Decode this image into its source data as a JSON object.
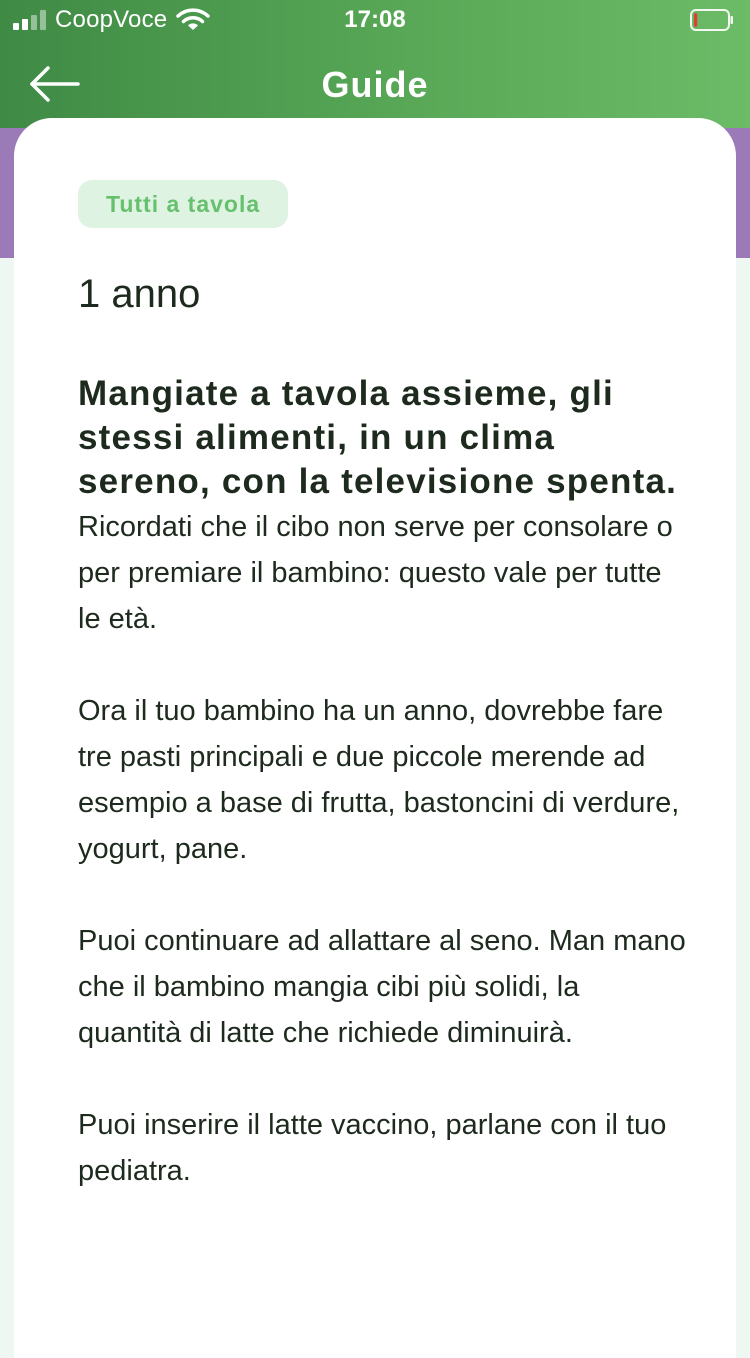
{
  "status_bar": {
    "carrier": "CoopVoce",
    "time": "17:08",
    "signal_bars_active": 2,
    "signal_bars_total": 4,
    "battery_level": 0.1,
    "battery_color": "#e53935"
  },
  "navbar": {
    "title": "Guide",
    "back_icon": "arrow-left-icon"
  },
  "article": {
    "tag": "Tutti a tavola",
    "age": "1 anno",
    "headline": "Mangiate a tavola assieme, gli stessi alimenti, in un clima sereno, con la televisione spenta.",
    "paragraphs": [
      "Ricordati che il cibo non serve per consolare o per premiare il bambino: questo vale per tutte le età.",
      "Ora il tuo bambino ha un anno, dovrebbe fare tre pasti principali e due piccole merende ad esempio a base di frutta, bastoncini di verdure, yogurt, pane.",
      "Puoi continuare ad allattare al seno. Man mano che il bambino mangia cibi più solidi, la quantità di latte che richiede diminuirà.",
      "Puoi inserire il latte vaccino, parlane con il tuo pediatra."
    ]
  },
  "colors": {
    "header_start": "#3f8a45",
    "header_end": "#6cbb67",
    "accent_band": "#9b7ab8",
    "tag_bg": "#dff3e2",
    "tag_text": "#67c06e",
    "text": "#1d2a1d"
  }
}
